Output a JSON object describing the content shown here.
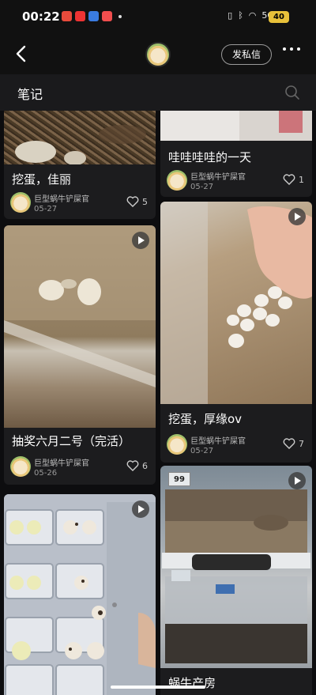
{
  "status": {
    "time": "00:22",
    "signal": "5G",
    "battery": "40"
  },
  "header": {
    "dm_label": "发私信"
  },
  "section": {
    "title": "笔记"
  },
  "cards": [
    {
      "title": "挖蛋，佳丽",
      "author": "巨型蜗牛铲屎官",
      "date": "05-27",
      "likes": "5"
    },
    {
      "title": "哇哇哇哇的一天",
      "author": "巨型蜗牛铲屎官",
      "date": "05-27",
      "likes": "1"
    },
    {
      "title": "抽奖六月二号（完活）",
      "author": "巨型蜗牛铲屎官",
      "date": "05-26",
      "likes": "6"
    },
    {
      "title": "挖蛋，厚缘ov",
      "author": "巨型蜗牛铲屎官",
      "date": "05-27",
      "likes": "7"
    },
    {
      "title": ""
    },
    {
      "title": "蜗牛产房"
    }
  ],
  "thermometer": {
    "reading": "99"
  }
}
